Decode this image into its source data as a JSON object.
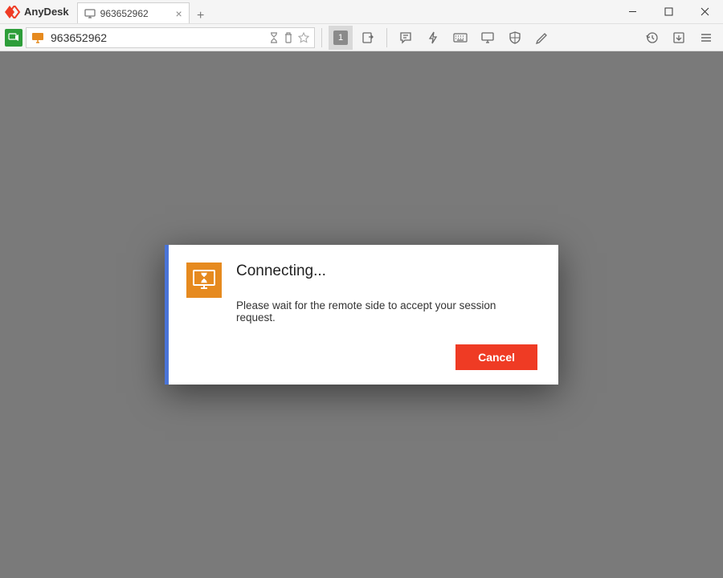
{
  "app": {
    "name": "AnyDesk"
  },
  "tabs": [
    {
      "label": "963652962"
    }
  ],
  "address": {
    "value": "963652962"
  },
  "toolbar": {
    "session_count": "1"
  },
  "dialog": {
    "title": "Connecting...",
    "message": "Please wait for the remote side to accept your session request.",
    "cancel": "Cancel"
  },
  "colors": {
    "accent_red": "#ef3b24",
    "accent_blue": "#4a74d8",
    "accent_orange": "#e68a1f",
    "status_green": "#2e9e3a"
  }
}
